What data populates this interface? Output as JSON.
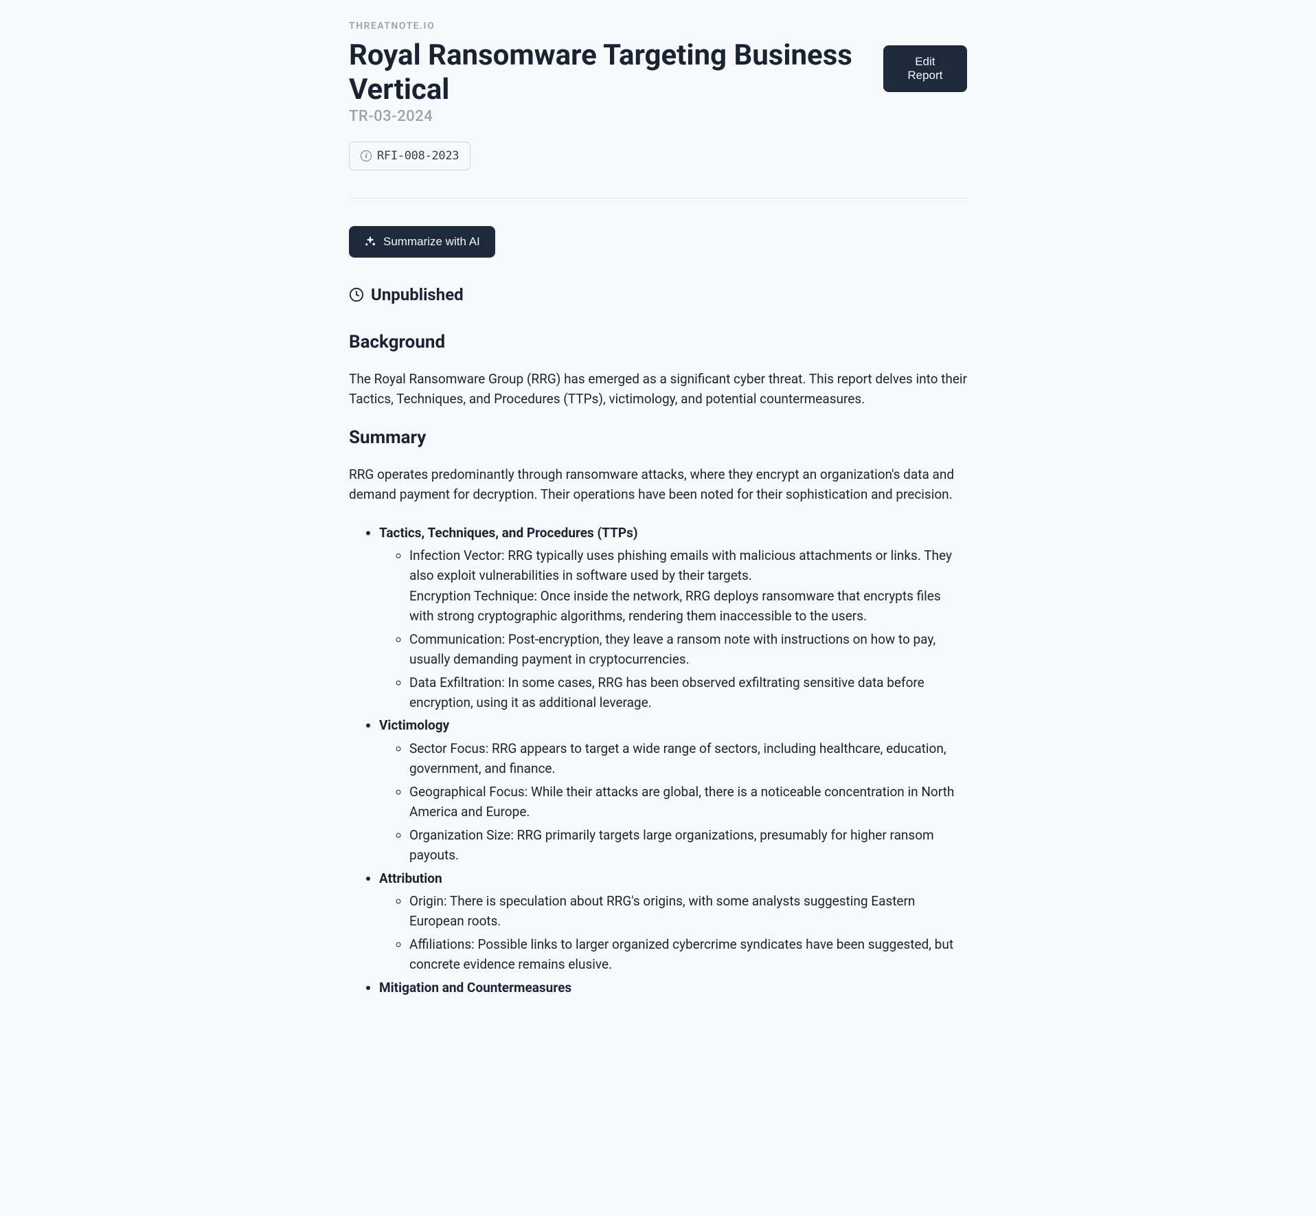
{
  "brand": "THREATNOTE.IO",
  "title": "Royal Ransomware Targeting Business Vertical",
  "report_id": "TR-03-2024",
  "edit_button": "Edit Report",
  "rfi_tag": "RFI-008-2023",
  "summarize_button": "Summarize with AI",
  "status": "Unpublished",
  "sections": {
    "background": {
      "heading": "Background",
      "text": "The Royal Ransomware Group (RRG) has emerged as a significant cyber threat. This report delves into their Tactics, Techniques, and Procedures (TTPs), victimology, and potential countermeasures."
    },
    "summary": {
      "heading": "Summary",
      "text": "RRG operates predominantly through ransomware attacks, where they encrypt an organization's data and demand payment for decryption. Their operations have been noted for their sophistication and precision."
    }
  },
  "bullets": {
    "ttps": {
      "heading": "Tactics, Techniques, and Procedures (TTPs)",
      "items": {
        "0a": "Infection Vector: RRG typically uses phishing emails with malicious attachments or links. They also exploit vulnerabilities in software used by their targets.",
        "0b": "Encryption Technique: Once inside the network, RRG deploys ransomware that encrypts files with strong cryptographic algorithms, rendering them inaccessible to the users.",
        "1": "Communication: Post-encryption, they leave a ransom note with instructions on how to pay, usually demanding payment in cryptocurrencies.",
        "2": "Data Exfiltration: In some cases, RRG has been observed exfiltrating sensitive data before encryption, using it as additional leverage."
      }
    },
    "victimology": {
      "heading": "Victimology",
      "items": {
        "0": "Sector Focus: RRG appears to target a wide range of sectors, including healthcare, education, government, and finance.",
        "1": "Geographical Focus: While their attacks are global, there is a noticeable concentration in North America and Europe.",
        "2": "Organization Size: RRG primarily targets large organizations, presumably for higher ransom payouts."
      }
    },
    "attribution": {
      "heading": "Attribution",
      "items": {
        "0": "Origin: There is speculation about RRG's origins, with some analysts suggesting Eastern European roots.",
        "1": "Affiliations: Possible links to larger organized cybercrime syndicates have been suggested, but concrete evidence remains elusive."
      }
    },
    "mitigation": {
      "heading": "Mitigation and Countermeasures"
    }
  }
}
